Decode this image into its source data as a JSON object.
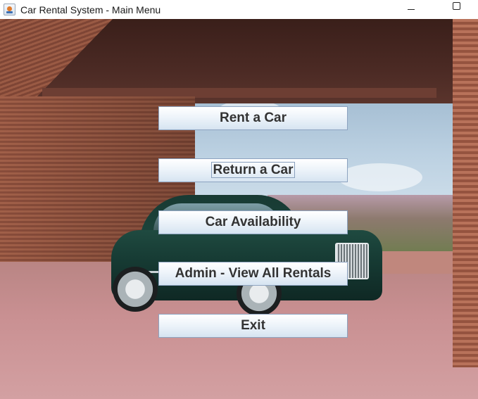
{
  "window": {
    "title": "Car Rental System - Main Menu",
    "app_icon": "java-coffee-cup-icon",
    "controls": [
      "minimize-icon",
      "maximize-icon"
    ]
  },
  "menu": {
    "rent_label": "Rent a Car",
    "return_label": "Return a Car",
    "availability_label": "Car Availability",
    "admin_label": "Admin - View All Rentals",
    "exit_label": "Exit",
    "focused": "Return a Car"
  }
}
